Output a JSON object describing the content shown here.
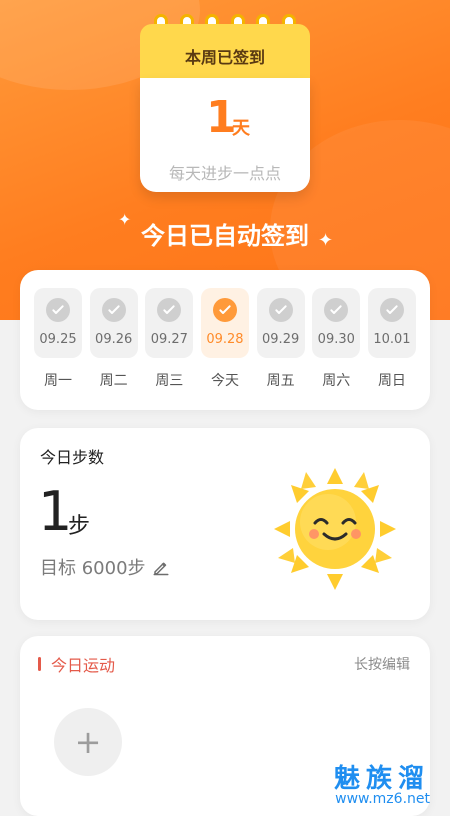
{
  "header": {
    "calendar_title": "本周已签到",
    "week_signin_days": "1",
    "week_signin_unit": "天",
    "slogan": "每天进步一点点",
    "status_text": "今日已自动签到"
  },
  "week": {
    "days": [
      {
        "date": "09.25",
        "label": "周一",
        "checked": true,
        "active": false
      },
      {
        "date": "09.26",
        "label": "周二",
        "checked": true,
        "active": false
      },
      {
        "date": "09.27",
        "label": "周三",
        "checked": true,
        "active": false
      },
      {
        "date": "09.28",
        "label": "今天",
        "checked": true,
        "active": true
      },
      {
        "date": "09.29",
        "label": "周五",
        "checked": true,
        "active": false
      },
      {
        "date": "09.30",
        "label": "周六",
        "checked": true,
        "active": false
      },
      {
        "date": "10.01",
        "label": "周日",
        "checked": true,
        "active": false
      }
    ]
  },
  "steps": {
    "title": "今日步数",
    "count": "1",
    "unit": "步",
    "goal_text": "目标 6000步",
    "edit_icon": "pencil-icon"
  },
  "exercise": {
    "title": "今日运动",
    "edit_hint": "长按编辑",
    "add_icon": "plus-icon"
  },
  "watermark": {
    "title": "魅族溜",
    "url": "www.mz6.net"
  },
  "colors": {
    "orange": "#ff7d1f",
    "yellow": "#ffd84c",
    "red": "#e45a4a",
    "gray_bg": "#f2f2f2"
  }
}
